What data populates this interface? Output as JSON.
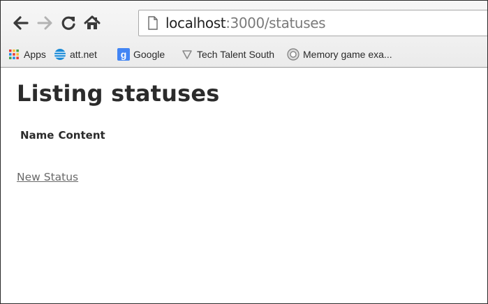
{
  "browser": {
    "url_host": "localhost",
    "url_path": ":3000/statuses",
    "bookmarks": [
      {
        "label": "Apps",
        "icon": "apps-grid-icon"
      },
      {
        "label": "att.net",
        "icon": "att-globe-icon"
      },
      {
        "label": "Google",
        "icon": "google-icon"
      },
      {
        "label": "Tech Talent South",
        "icon": "tech-talent-south-icon"
      },
      {
        "label": "Memory game exa...",
        "icon": "memory-game-icon"
      }
    ]
  },
  "page": {
    "title": "Listing statuses",
    "table_headers": [
      "Name",
      "Content"
    ],
    "new_status_link": "New Status"
  },
  "colors": {
    "text": "#2b2b2b",
    "link": "#6a6a6a",
    "google_blue": "#4285f4",
    "att_blue": "#1a8ad6"
  }
}
